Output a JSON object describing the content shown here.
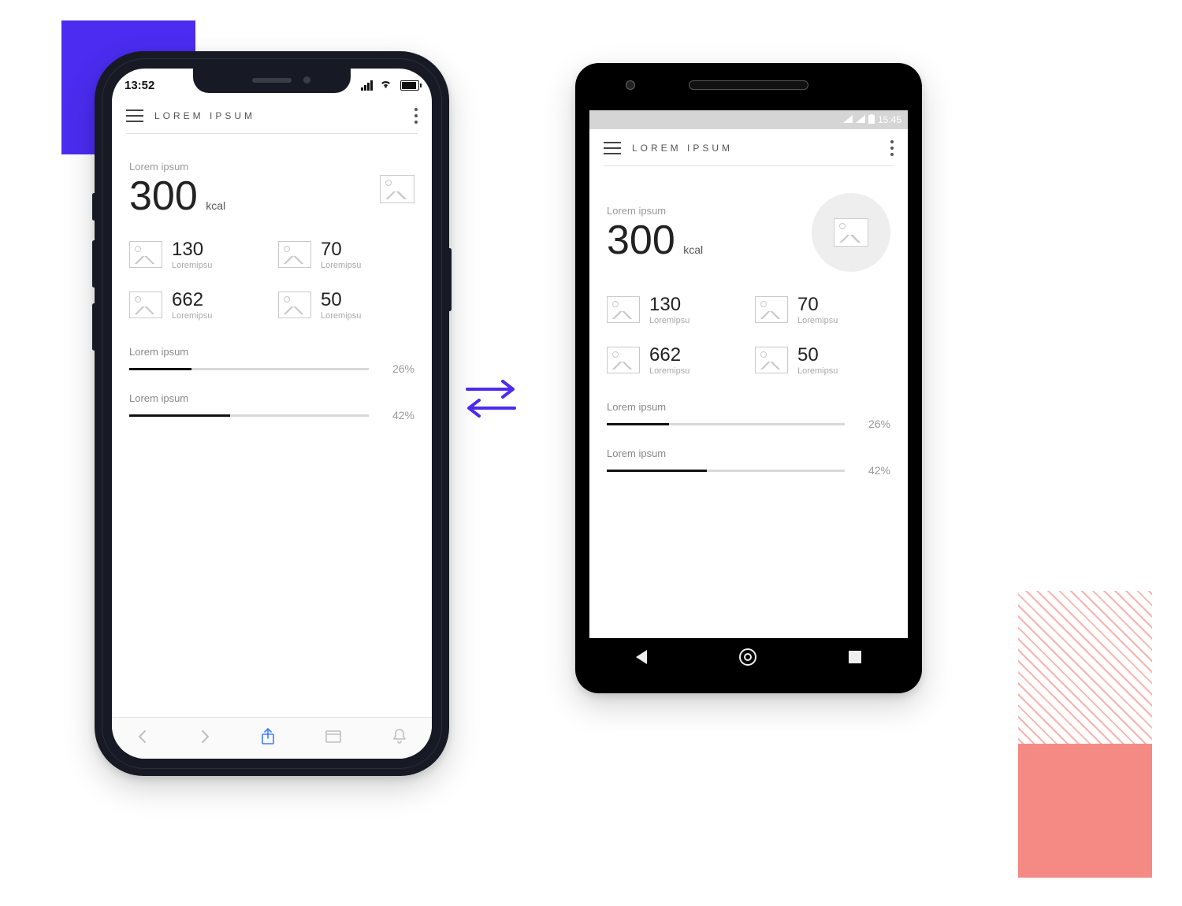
{
  "status": {
    "time_ios": "13:52",
    "time_android": "15:45"
  },
  "appbar": {
    "title": "LOREM IPSUM"
  },
  "hero": {
    "label": "Lorem ipsum",
    "value": "300",
    "unit": "kcal"
  },
  "stats": [
    {
      "value": "130",
      "label": "Loremipsu"
    },
    {
      "value": "70",
      "label": "Loremipsu"
    },
    {
      "value": "662",
      "label": "Loremipsu"
    },
    {
      "value": "50",
      "label": "Loremipsu"
    }
  ],
  "progress": [
    {
      "label": "Lorem ipsum",
      "percent": 26,
      "display": "26%"
    },
    {
      "label": "Lorem ipsum",
      "percent": 42,
      "display": "42%"
    }
  ]
}
